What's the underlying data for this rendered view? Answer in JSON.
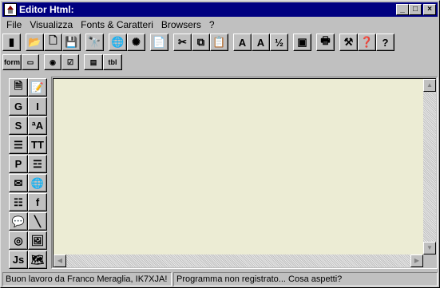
{
  "window": {
    "title": "Editor Html:"
  },
  "menu": [
    {
      "label": "File"
    },
    {
      "label": "Visualizza"
    },
    {
      "label": "Fonts & Caratteri"
    },
    {
      "label": "Browsers"
    },
    {
      "label": "?"
    }
  ],
  "toolbar1": [
    {
      "name": "exit-icon",
      "glyph": "▮"
    },
    {
      "name": "open-folder-icon",
      "glyph": "📂"
    },
    {
      "name": "new-document-icon",
      "glyph": "🗋"
    },
    {
      "name": "save-icon",
      "glyph": "💾"
    },
    {
      "name": "find-binoculars-icon",
      "glyph": "🔭"
    },
    {
      "name": "browser-preview-icon",
      "glyph": "🌐"
    },
    {
      "name": "color-burst-icon",
      "glyph": "✺"
    },
    {
      "name": "notepad-icon",
      "glyph": "📄"
    },
    {
      "name": "cut-icon",
      "glyph": "✂"
    },
    {
      "name": "copy-icon",
      "glyph": "⧉"
    },
    {
      "name": "paste-icon",
      "glyph": "📋"
    },
    {
      "name": "font-larger-icon",
      "glyph": "A"
    },
    {
      "name": "font-smaller-icon",
      "glyph": "A"
    },
    {
      "name": "fraction-icon",
      "glyph": "½"
    },
    {
      "name": "frame-icon",
      "glyph": "▣"
    },
    {
      "name": "print-icon",
      "glyph": "🖶"
    },
    {
      "name": "tools-icon",
      "glyph": "⚒"
    },
    {
      "name": "wizard-help-icon",
      "glyph": "❓"
    },
    {
      "name": "help-icon",
      "glyph": "?"
    }
  ],
  "toolbar2": [
    {
      "name": "form-icon",
      "label": "form"
    },
    {
      "name": "text-field-icon",
      "label": "▭"
    },
    {
      "name": "radio-button-icon",
      "label": "◉"
    },
    {
      "name": "checkbox-icon",
      "label": "☑"
    },
    {
      "name": "list-box-icon",
      "label": "▤"
    },
    {
      "name": "tab-icon",
      "label": "tbl"
    }
  ],
  "sidebar": [
    {
      "name": "new-page-icon",
      "glyph": "🗎"
    },
    {
      "name": "page-template-icon",
      "glyph": "📝"
    },
    {
      "name": "bold-icon",
      "glyph": "G"
    },
    {
      "name": "italic-icon",
      "glyph": "I"
    },
    {
      "name": "underline-icon",
      "glyph": "S"
    },
    {
      "name": "font-color-icon",
      "glyph": "ªA"
    },
    {
      "name": "align-center-icon",
      "glyph": "☰"
    },
    {
      "name": "teletype-icon",
      "glyph": "TT"
    },
    {
      "name": "paragraph-icon",
      "glyph": "P"
    },
    {
      "name": "horizontal-rule-icon",
      "glyph": "☲"
    },
    {
      "name": "mail-link-icon",
      "glyph": "✉"
    },
    {
      "name": "web-link-icon",
      "glyph": "🌐"
    },
    {
      "name": "numbered-list-icon",
      "glyph": "☷"
    },
    {
      "name": "function-icon",
      "glyph": "f"
    },
    {
      "name": "comment-icon",
      "glyph": "💬"
    },
    {
      "name": "line-icon",
      "glyph": "╲"
    },
    {
      "name": "anchor-target-icon",
      "glyph": "◎"
    },
    {
      "name": "image-icon",
      "glyph": "🖼"
    },
    {
      "name": "javascript-icon",
      "glyph": "Js"
    },
    {
      "name": "map-icon",
      "glyph": "🗺"
    }
  ],
  "status": {
    "left": "Buon lavoro da Franco Meraglia, IK7XJA!",
    "right": "Programma non registrato... Cosa aspetti?"
  },
  "colors": {
    "title_bg": "#000080",
    "editor_bg": "#ececd4",
    "face": "#c0c0c0"
  }
}
